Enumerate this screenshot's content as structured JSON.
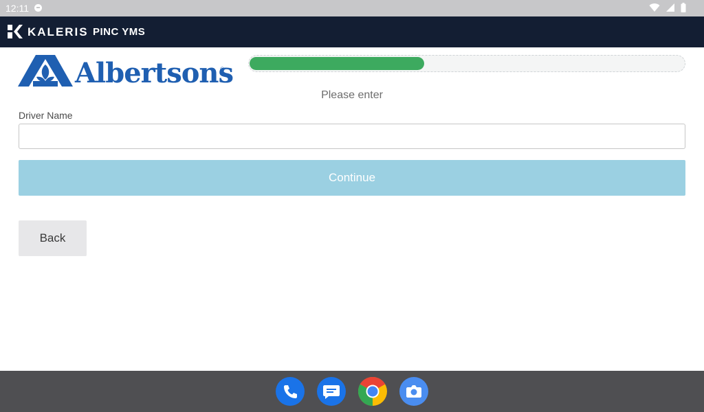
{
  "status_bar": {
    "time": "12:11",
    "icons": [
      "message-icon",
      "wifi-icon",
      "signal-icon",
      "battery-icon"
    ]
  },
  "app_bar": {
    "brand": "KALERIS",
    "product": "PINC YMS",
    "background": "#131e33"
  },
  "logo": {
    "text": "Albertsons",
    "registered_mark": "®",
    "color": "#1f5fb1"
  },
  "progress": {
    "percent": 40,
    "fill_color": "#3daa5f"
  },
  "form": {
    "prompt": "Please enter",
    "driver_name_label": "Driver Name",
    "driver_name_value": "",
    "continue_label": "Continue",
    "back_label": "Back",
    "continue_color": "#9bd0e2"
  },
  "dock": {
    "apps": [
      "phone-icon",
      "messages-icon",
      "chrome-icon",
      "camera-icon"
    ]
  }
}
